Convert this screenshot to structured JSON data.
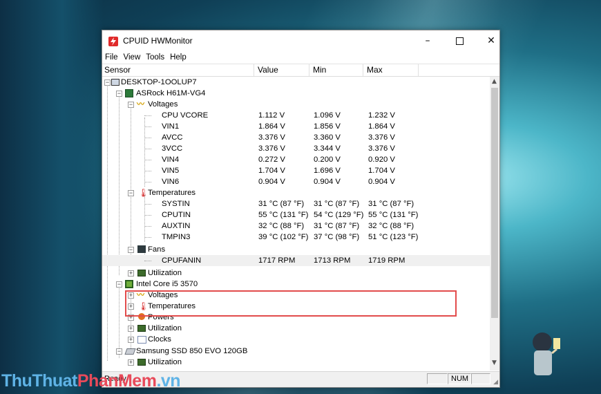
{
  "window": {
    "title": "CPUID HWMonitor",
    "controls": {
      "minimize": "–",
      "close": "✕"
    }
  },
  "menu": [
    "File",
    "View",
    "Tools",
    "Help"
  ],
  "columns": [
    "Sensor",
    "Value",
    "Min",
    "Max"
  ],
  "rows": [
    {
      "label": "DESKTOP-1OOLUP7",
      "icon": "computer-icon"
    },
    {
      "label": "ASRock H61M-VG4",
      "icon": "motherboard-icon"
    },
    {
      "label": "Voltages",
      "icon": "voltage-icon"
    },
    {
      "label": "CPU VCORE",
      "value": "1.112 V",
      "min": "1.096 V",
      "max": "1.232 V"
    },
    {
      "label": "VIN1",
      "value": "1.864 V",
      "min": "1.856 V",
      "max": "1.864 V"
    },
    {
      "label": "AVCC",
      "value": "3.376 V",
      "min": "3.360 V",
      "max": "3.376 V"
    },
    {
      "label": "3VCC",
      "value": "3.376 V",
      "min": "3.344 V",
      "max": "3.376 V"
    },
    {
      "label": "VIN4",
      "value": "0.272 V",
      "min": "0.200 V",
      "max": "0.920 V"
    },
    {
      "label": "VIN5",
      "value": "1.704 V",
      "min": "1.696 V",
      "max": "1.704 V"
    },
    {
      "label": "VIN6",
      "value": "0.904 V",
      "min": "0.904 V",
      "max": "0.904 V"
    },
    {
      "label": "Temperatures",
      "icon": "thermometer-icon"
    },
    {
      "label": "SYSTIN",
      "value": "31 °C  (87 °F)",
      "min": "31 °C  (87 °F)",
      "max": "31 °C  (87 °F)"
    },
    {
      "label": "CPUTIN",
      "value": "55 °C  (131 °F)",
      "min": "54 °C  (129 °F)",
      "max": "55 °C  (131 °F)"
    },
    {
      "label": "AUXTIN",
      "value": "32 °C  (88 °F)",
      "min": "31 °C  (87 °F)",
      "max": "32 °C  (88 °F)"
    },
    {
      "label": "TMPIN3",
      "value": "39 °C  (102 °F)",
      "min": "37 °C  (98 °F)",
      "max": "51 °C  (123 °F)"
    },
    {
      "label": "Fans",
      "icon": "fan-icon"
    },
    {
      "label": "CPUFANIN",
      "value": "1717 RPM",
      "min": "1713 RPM",
      "max": "1719 RPM"
    },
    {
      "label": "Utilization",
      "icon": "utilization-icon"
    },
    {
      "label": "Intel Core i5 3570",
      "icon": "cpu-icon"
    },
    {
      "label": "Voltages",
      "icon": "voltage-icon"
    },
    {
      "label": "Temperatures",
      "icon": "thermometer-icon"
    },
    {
      "label": "Powers",
      "icon": "power-icon"
    },
    {
      "label": "Utilization",
      "icon": "utilization-icon"
    },
    {
      "label": "Clocks",
      "icon": "clock-icon"
    },
    {
      "label": "Samsung SSD 850 EVO 120GB",
      "icon": "drive-icon"
    },
    {
      "label": "Utilization",
      "icon": "utilization-icon"
    }
  ],
  "status": {
    "text": "Ready",
    "num": "NUM"
  },
  "watermark": {
    "part1": "ThuThuat",
    "part2": "PhanMem",
    "part3": ".vn"
  },
  "colors": {
    "highlight": "#e24b4b",
    "watermark_blue": "#5fb3e6",
    "watermark_red": "#e84a5a"
  }
}
